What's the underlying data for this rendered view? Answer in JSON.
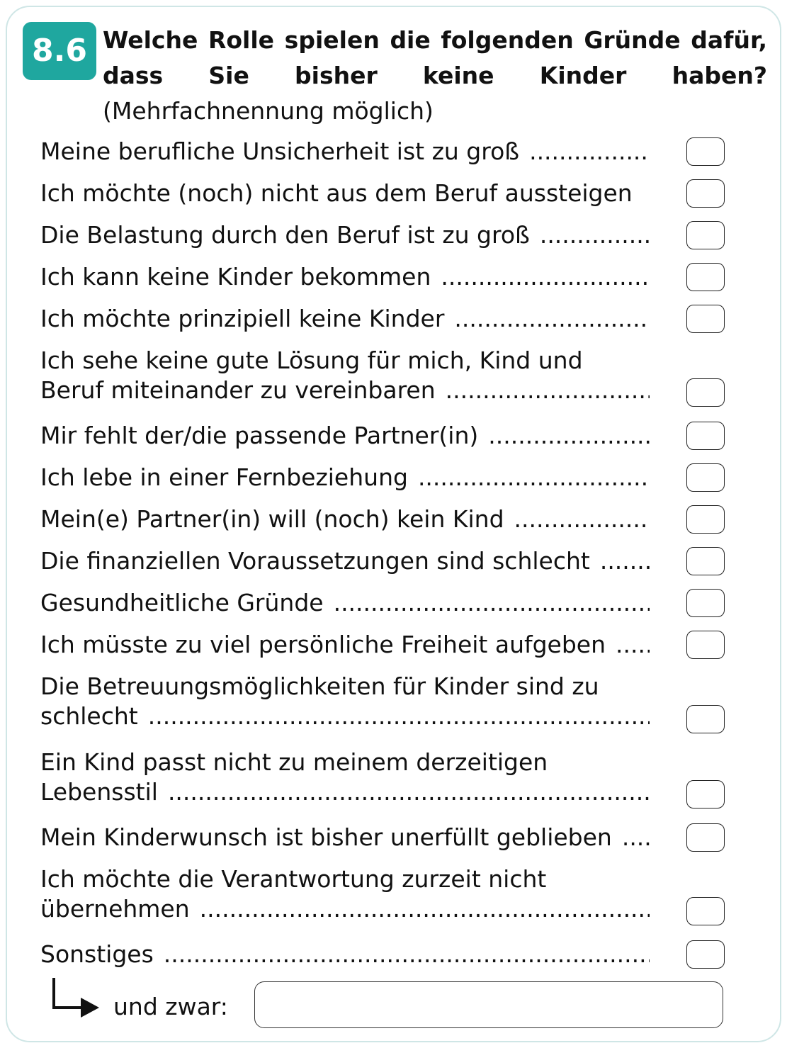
{
  "question": {
    "number": "8.6",
    "text_bold": "Welche Rolle spielen die folgenden Gründe dafür, dass Sie bisher keine Kinder haben?",
    "text_note": "(Mehrfachnennung möglich)"
  },
  "options": [
    {
      "line1": "Meine berufliche Unsicherheit ist zu groß"
    },
    {
      "line1": "Ich möchte (noch) nicht aus dem Beruf aussteigen"
    },
    {
      "line1": "Die Belastung durch den Beruf ist zu groß"
    },
    {
      "line1": "Ich kann keine Kinder bekommen"
    },
    {
      "line1": "Ich möchte prinzipiell keine Kinder"
    },
    {
      "line1": "Ich sehe keine gute Lösung für mich, Kind und",
      "line2": "Beruf miteinander zu vereinbaren"
    },
    {
      "line1": "Mir fehlt der/die passende Partner(in)"
    },
    {
      "line1": "Ich lebe in einer Fernbeziehung"
    },
    {
      "line1": "Mein(e) Partner(in) will (noch) kein Kind"
    },
    {
      "line1": "Die finanziellen Voraussetzungen sind schlecht"
    },
    {
      "line1": "Gesundheitliche Gründe"
    },
    {
      "line1": "Ich müsste zu viel persönliche Freiheit aufgeben"
    },
    {
      "line1": "Die Betreuungsmöglichkeiten für Kinder sind zu",
      "line2": "schlecht"
    },
    {
      "line1": "Ein Kind passt nicht zu meinem derzeitigen",
      "line2": "Lebensstil"
    },
    {
      "line1": "Mein Kinderwunsch ist bisher unerfüllt geblieben"
    },
    {
      "line1": "Ich möchte die Verantwortung zurzeit nicht",
      "line2": "übernehmen"
    },
    {
      "line1": "Sonstiges"
    }
  ],
  "other": {
    "label": "und zwar:",
    "value": ""
  },
  "colors": {
    "accent": "#1fa79f",
    "border": "#cfe6e6"
  }
}
